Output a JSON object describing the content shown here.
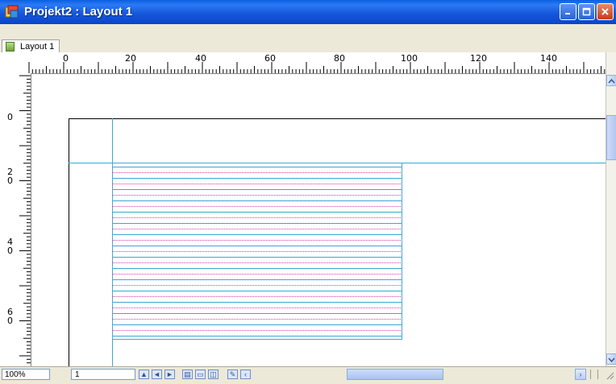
{
  "window": {
    "title": "Projekt2 : Layout 1",
    "title_color": "#ffffff",
    "title_bar_color": "#0a5fe0"
  },
  "tabs": [
    {
      "label": "Layout 1",
      "active": true,
      "icon": "layout-page-icon"
    }
  ],
  "hruler": {
    "labels": [
      "0",
      "20",
      "40",
      "60",
      "80",
      "100",
      "120",
      "140"
    ]
  },
  "vruler": {
    "labels": [
      {
        "top": "",
        "bottom": "0"
      },
      {
        "top": "2",
        "bottom": "0"
      },
      {
        "top": "4",
        "bottom": "0"
      },
      {
        "top": "6",
        "bottom": "0"
      }
    ]
  },
  "guides": {
    "guide_color": "#3aa7d4",
    "line_colors": [
      "#3aa7d4",
      "#d23ca5"
    ]
  },
  "statusbar": {
    "zoom": "100%",
    "page": "1",
    "icons": [
      "first-page-icon",
      "prev-page-icon",
      "next-page-icon",
      "layout-view-icon",
      "two-page-icon",
      "spread-view-icon",
      "edit-icon",
      "scroll-left-icon",
      "scroll-right-icon"
    ]
  }
}
